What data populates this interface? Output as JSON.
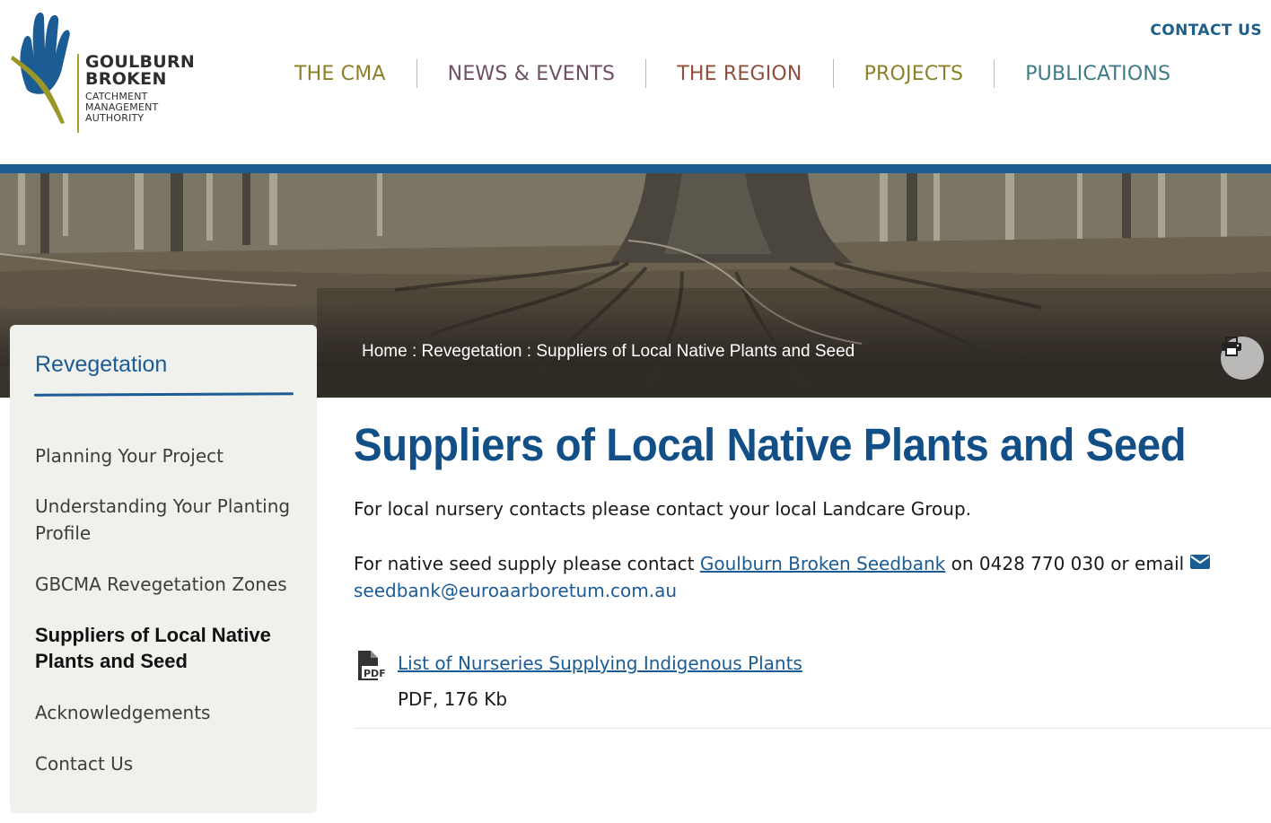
{
  "site": {
    "logo_name_line1": "GOULBURN",
    "logo_name_line2": "BROKEN",
    "logo_sub_line1": "CATCHMENT",
    "logo_sub_line2": "MANAGEMENT",
    "logo_sub_line3": "AUTHORITY",
    "contact_label": "CONTACT US",
    "brand_blue": "#1c5c94"
  },
  "nav": {
    "items": [
      {
        "label": "THE CMA",
        "color": "#8c7f2a"
      },
      {
        "label": "NEWS & EVENTS",
        "color": "#6e4f63"
      },
      {
        "label": "THE REGION",
        "color": "#8e4f3c"
      },
      {
        "label": "PROJECTS",
        "color": "#8a8227"
      },
      {
        "label": "PUBLICATIONS",
        "color": "#3f7b86"
      }
    ]
  },
  "breadcrumb": {
    "home": "Home",
    "section": "Revegetation",
    "current": "Suppliers of Local Native Plants and Seed",
    "separator": " : "
  },
  "print_icon": "printer-icon",
  "sidebar": {
    "title": "Revegetation",
    "items": [
      {
        "label": "Planning Your Project"
      },
      {
        "label": "Understanding Your Planting Profile"
      },
      {
        "label": "GBCMA Revegetation Zones"
      },
      {
        "label": "Suppliers of Local Native Plants and Seed",
        "active": true
      },
      {
        "label": "Acknowledgements"
      },
      {
        "label": "Contact Us"
      }
    ]
  },
  "main": {
    "title": "Suppliers of Local Native Plants and Seed",
    "para1": "For local nursery contacts please contact your local Landcare Group.",
    "para2_prefix": "For native seed supply please contact ",
    "para2_link": "Goulburn Broken Seedbank",
    "para2_middle": " on 0428 770 030 or email",
    "email": "seedbank@euroaarboretum.com.au",
    "document": {
      "link_label": "List of Nurseries Supplying Indigenous Plants",
      "icon_label": "PDF",
      "meta": "PDF, 176 Kb"
    }
  }
}
